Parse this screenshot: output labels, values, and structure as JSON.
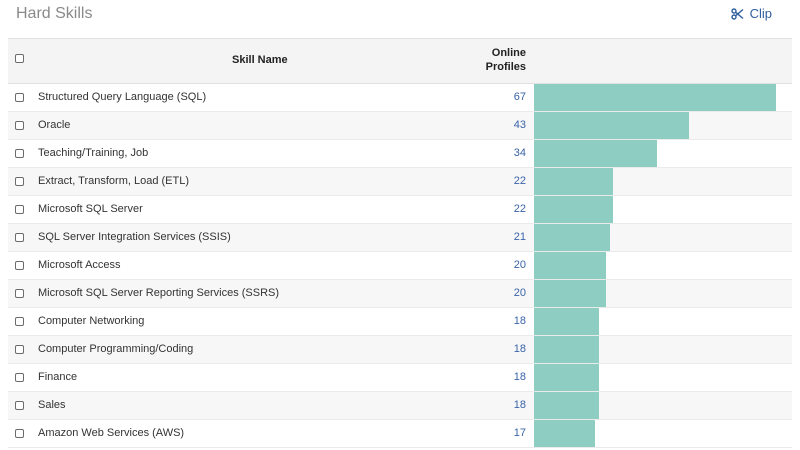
{
  "header": {
    "title": "Hard Skills",
    "clip_label": "Clip"
  },
  "table": {
    "columns": {
      "skill": "Skill Name",
      "profiles_line1": "Online",
      "profiles_line2": "Profiles"
    },
    "max_value": 67,
    "rows": [
      {
        "name": "Structured Query Language (SQL)",
        "count": 67
      },
      {
        "name": "Oracle",
        "count": 43
      },
      {
        "name": "Teaching/Training, Job",
        "count": 34
      },
      {
        "name": "Extract, Transform, Load (ETL)",
        "count": 22
      },
      {
        "name": "Microsoft SQL Server",
        "count": 22
      },
      {
        "name": "SQL Server Integration Services (SSIS)",
        "count": 21
      },
      {
        "name": "Microsoft Access",
        "count": 20
      },
      {
        "name": "Microsoft SQL Server Reporting Services (SSRS)",
        "count": 20
      },
      {
        "name": "Computer Networking",
        "count": 18
      },
      {
        "name": "Computer Programming/Coding",
        "count": 18
      },
      {
        "name": "Finance",
        "count": 18
      },
      {
        "name": "Sales",
        "count": 18
      },
      {
        "name": "Amazon Web Services (AWS)",
        "count": 17
      }
    ]
  },
  "colors": {
    "bar": "#8ecdc2",
    "count_text": "#3a63a8",
    "clip": "#2f5f9e"
  },
  "icons": {
    "clip": "scissors-icon",
    "checkbox": "checkbox-icon"
  }
}
